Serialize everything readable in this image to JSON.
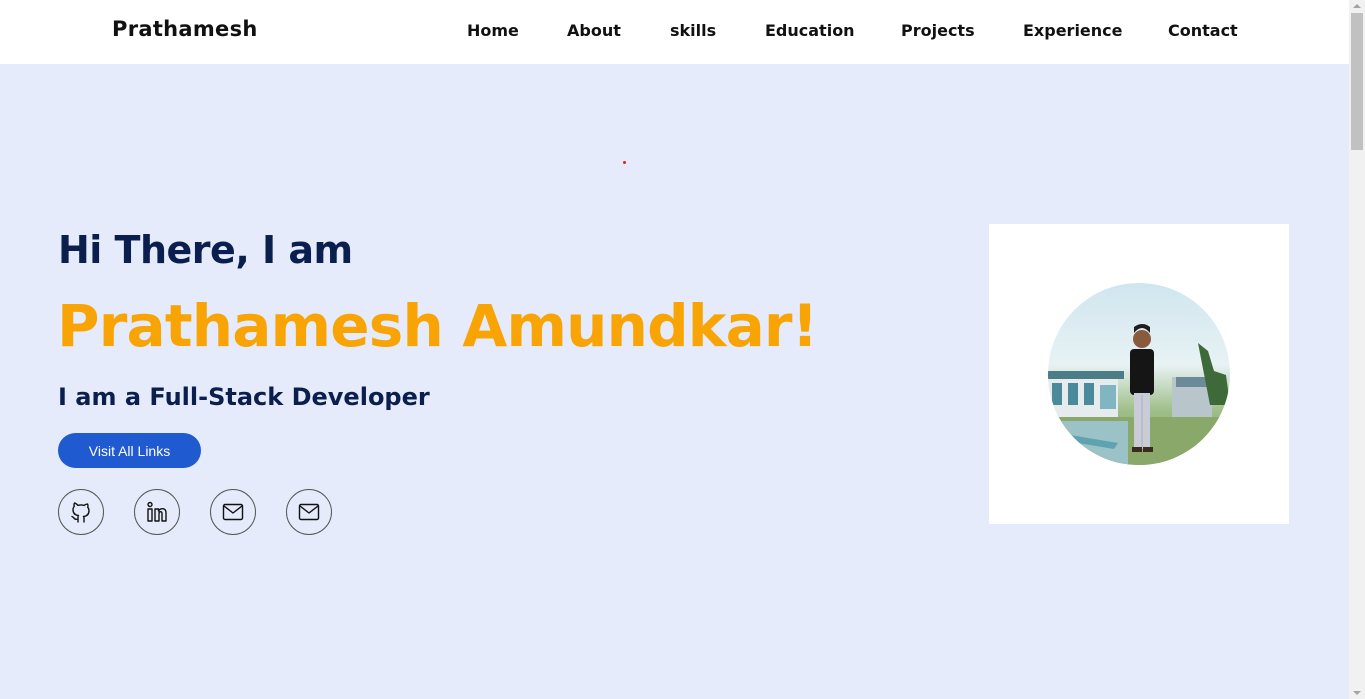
{
  "nav": {
    "brand": "Prathamesh",
    "links": [
      "Home",
      "About",
      "skills",
      "Education",
      "Projects",
      "Experience",
      "Contact"
    ]
  },
  "hero": {
    "greeting": "Hi There, I am",
    "name": "Prathamesh Amundkar!",
    "role": "I am a Full-Stack Developer",
    "button_label": "Visit All Links",
    "social_icons": [
      "github-icon",
      "linkedin-icon",
      "mail-icon",
      "mail-icon"
    ]
  },
  "colors": {
    "background": "#e5ebfa",
    "navy": "#0b1f4f",
    "accent": "#f7a404",
    "button": "#1f5ad1"
  }
}
